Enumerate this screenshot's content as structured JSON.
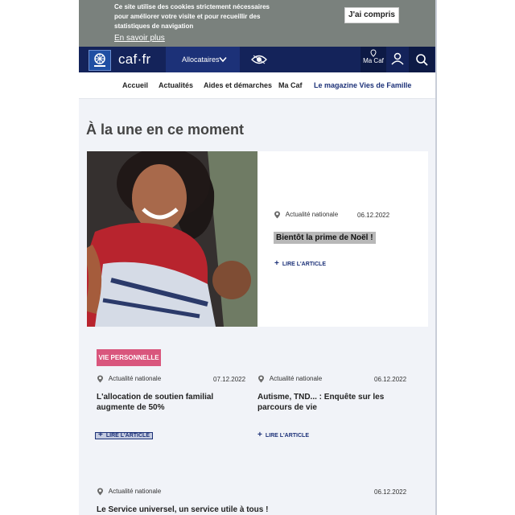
{
  "cookie": {
    "text": "Ce site utilise des cookies strictement nécessaires pour améliorer votre visite et pour recueillir des statistiques de navigation",
    "link": "En savoir plus",
    "button": "J'ai compris"
  },
  "topnav": {
    "brand": "caf·fr",
    "allocataires": "Allocataires",
    "macaf": "Ma Caf"
  },
  "subnav": [
    "Accueil",
    "Actualités",
    "Aides et démarches",
    "Ma Caf",
    "Le magazine Vies de Famille"
  ],
  "heading": "À la une en ce moment",
  "featured": {
    "category": "Actualité nationale",
    "date": "06.12.2022",
    "title": "Bientôt la prime de Noël !",
    "lire": "LIRE L'ARTICLE"
  },
  "badge": "VIE PERSONNELLE",
  "articles": [
    {
      "category": "Actualité nationale",
      "date": "07.12.2022",
      "title": "L'allocation de soutien familial augmente de 50%",
      "lire": "LIRE L'ARTICLE"
    },
    {
      "category": "Actualité nationale",
      "date": "06.12.2022",
      "title": "Autisme, TND... : Enquête sur les parcours de vie",
      "lire": "LIRE L'ARTICLE"
    },
    {
      "category": "Actualité nationale",
      "date": "06.12.2022",
      "title": "Le Service universel, un service utile à tous !"
    }
  ]
}
